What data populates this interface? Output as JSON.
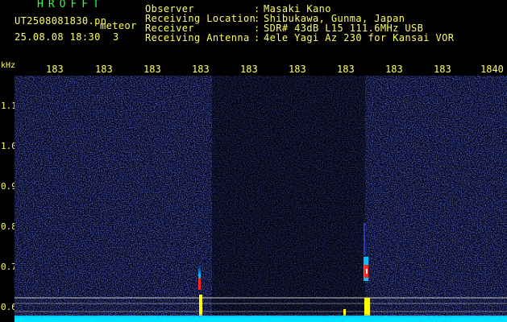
{
  "header": {
    "app_title": "HROFFT",
    "file_name": "UT2508081830.pn",
    "meteor_tag": "meteor",
    "date_time": "25.08.08 18:30",
    "count": "3",
    "info": [
      {
        "label": "Observer",
        "value": "Masaki Kano"
      },
      {
        "label": "Receiving Location",
        "value": "Shibukawa, Gunma, Japan"
      },
      {
        "label": "Receiver",
        "value": "SDR# 43dB L15 111.6MHz USB"
      },
      {
        "label": "Receiving Antenna",
        "value": "4ele Yagi Az 230 for Kansai VOR"
      }
    ]
  },
  "axes": {
    "unit_label": "kHz",
    "time_labels": [
      "183",
      "183",
      "183",
      "183",
      "183",
      "183",
      "183",
      "183",
      "183",
      "1840"
    ],
    "freq_labels": [
      "1.1",
      "1.0",
      "0.9",
      "0.8",
      "0.7",
      "0.6"
    ]
  },
  "colors": {
    "background": "#000000",
    "label_text": "#ffff60",
    "title_text": "#30ff30",
    "noise_blue": "#1e2ea8",
    "baseline_cyan": "#00e0ff",
    "echo_red": "#ff2020",
    "ref_line": "#c8c8c8"
  }
}
